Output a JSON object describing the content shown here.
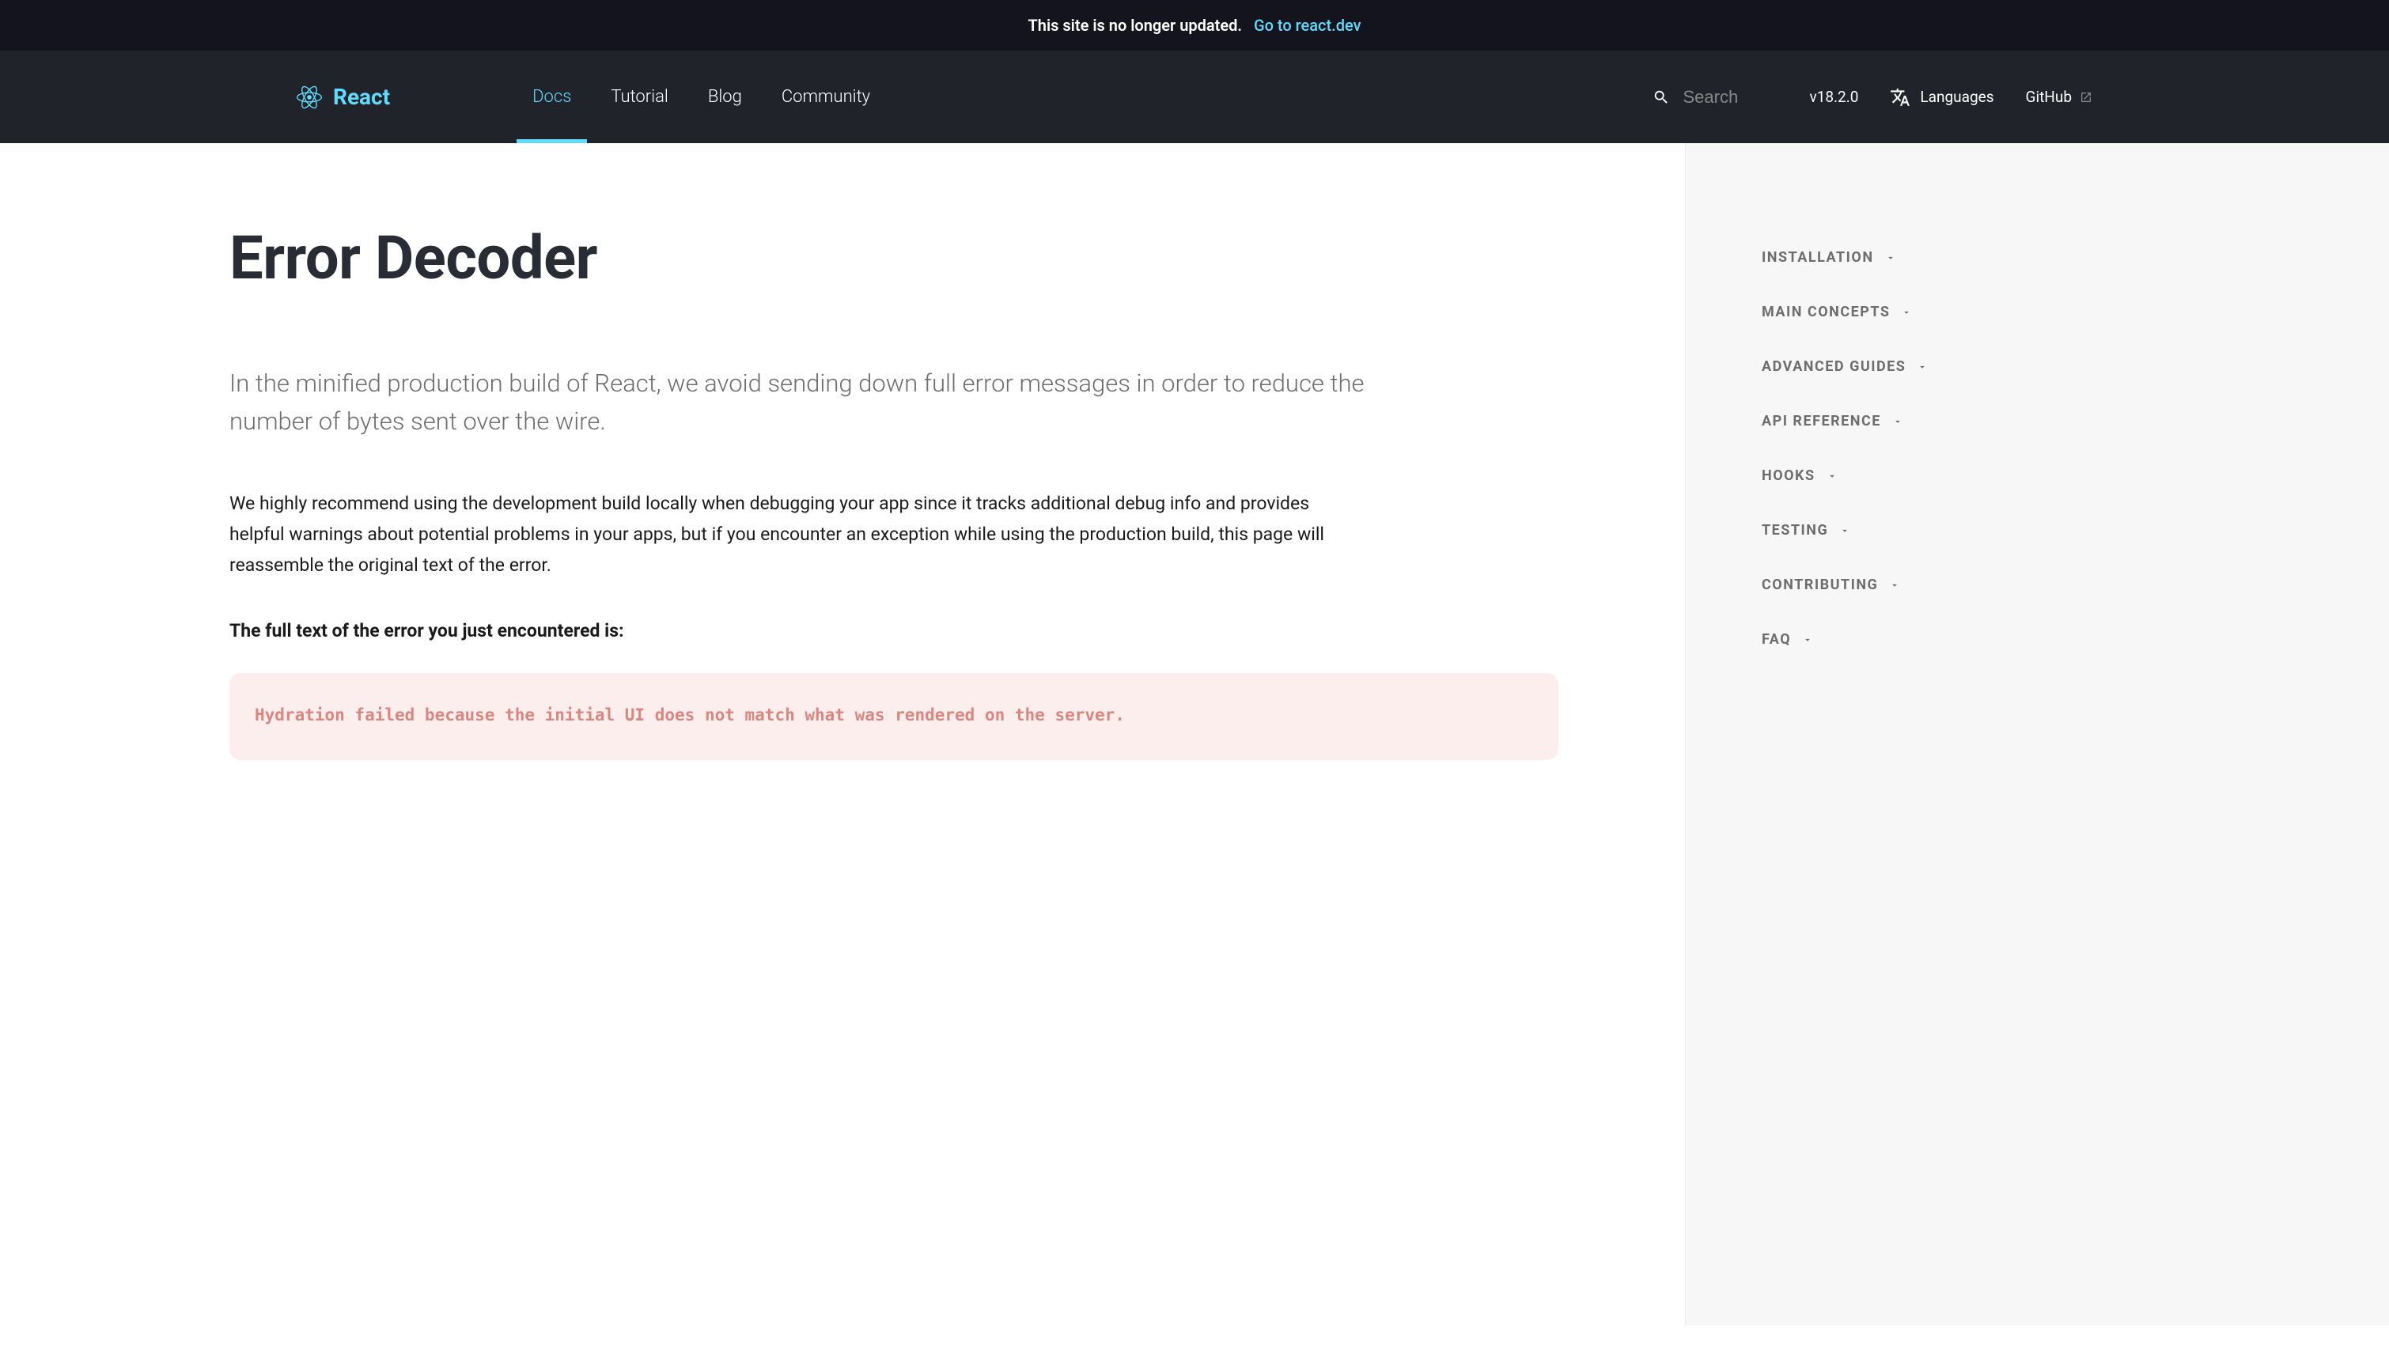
{
  "announcement": {
    "text": "This site is no longer updated.",
    "link_text": "Go to react.dev"
  },
  "header": {
    "logo_text": "React",
    "nav": [
      {
        "label": "Docs",
        "active": true
      },
      {
        "label": "Tutorial",
        "active": false
      },
      {
        "label": "Blog",
        "active": false
      },
      {
        "label": "Community",
        "active": false
      }
    ],
    "search_placeholder": "Search",
    "version": "v18.2.0",
    "languages_label": "Languages",
    "github_label": "GitHub"
  },
  "main": {
    "title": "Error Decoder",
    "intro": "In the minified production build of React, we avoid sending down full error messages in order to reduce the number of bytes sent over the wire.",
    "body": "We highly recommend using the development build locally when debugging your app since it tracks additional debug info and provides helpful warnings about potential problems in your apps, but if you encounter an exception while using the production build, this page will reassemble the original text of the error.",
    "bold_label": "The full text of the error you just encountered is:",
    "error_message": "Hydration failed because the initial UI does not match what was rendered on the server."
  },
  "sidebar": {
    "items": [
      {
        "label": "Installation"
      },
      {
        "label": "Main Concepts"
      },
      {
        "label": "Advanced Guides"
      },
      {
        "label": "API Reference"
      },
      {
        "label": "Hooks"
      },
      {
        "label": "Testing"
      },
      {
        "label": "Contributing"
      },
      {
        "label": "FAQ"
      }
    ]
  }
}
